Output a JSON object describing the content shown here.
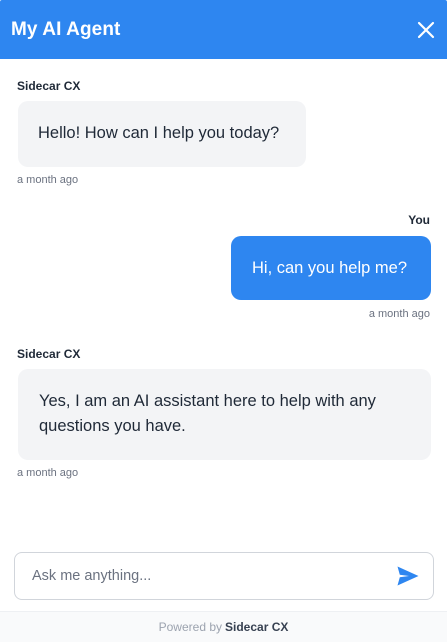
{
  "header": {
    "title": "My AI Agent",
    "close_icon": "close-icon",
    "background": "#2e86f0"
  },
  "messages": [
    {
      "role": "agent",
      "sender": "Sidecar CX",
      "text": "Hello! How can I help you today?",
      "time": "a month ago"
    },
    {
      "role": "user",
      "sender": "You",
      "text": "Hi, can you help me?",
      "time": "a month ago"
    },
    {
      "role": "agent",
      "sender": "Sidecar CX",
      "text": "Yes, I am an AI assistant here to help with any questions you have.",
      "time": "a month ago"
    }
  ],
  "composer": {
    "placeholder": "Ask me anything...",
    "value": "",
    "send_icon": "send-icon"
  },
  "footer": {
    "powered_by": "Powered by",
    "brand": "Sidecar CX"
  },
  "colors": {
    "accent": "#2e86f0",
    "agent_bubble": "#f3f4f6"
  }
}
